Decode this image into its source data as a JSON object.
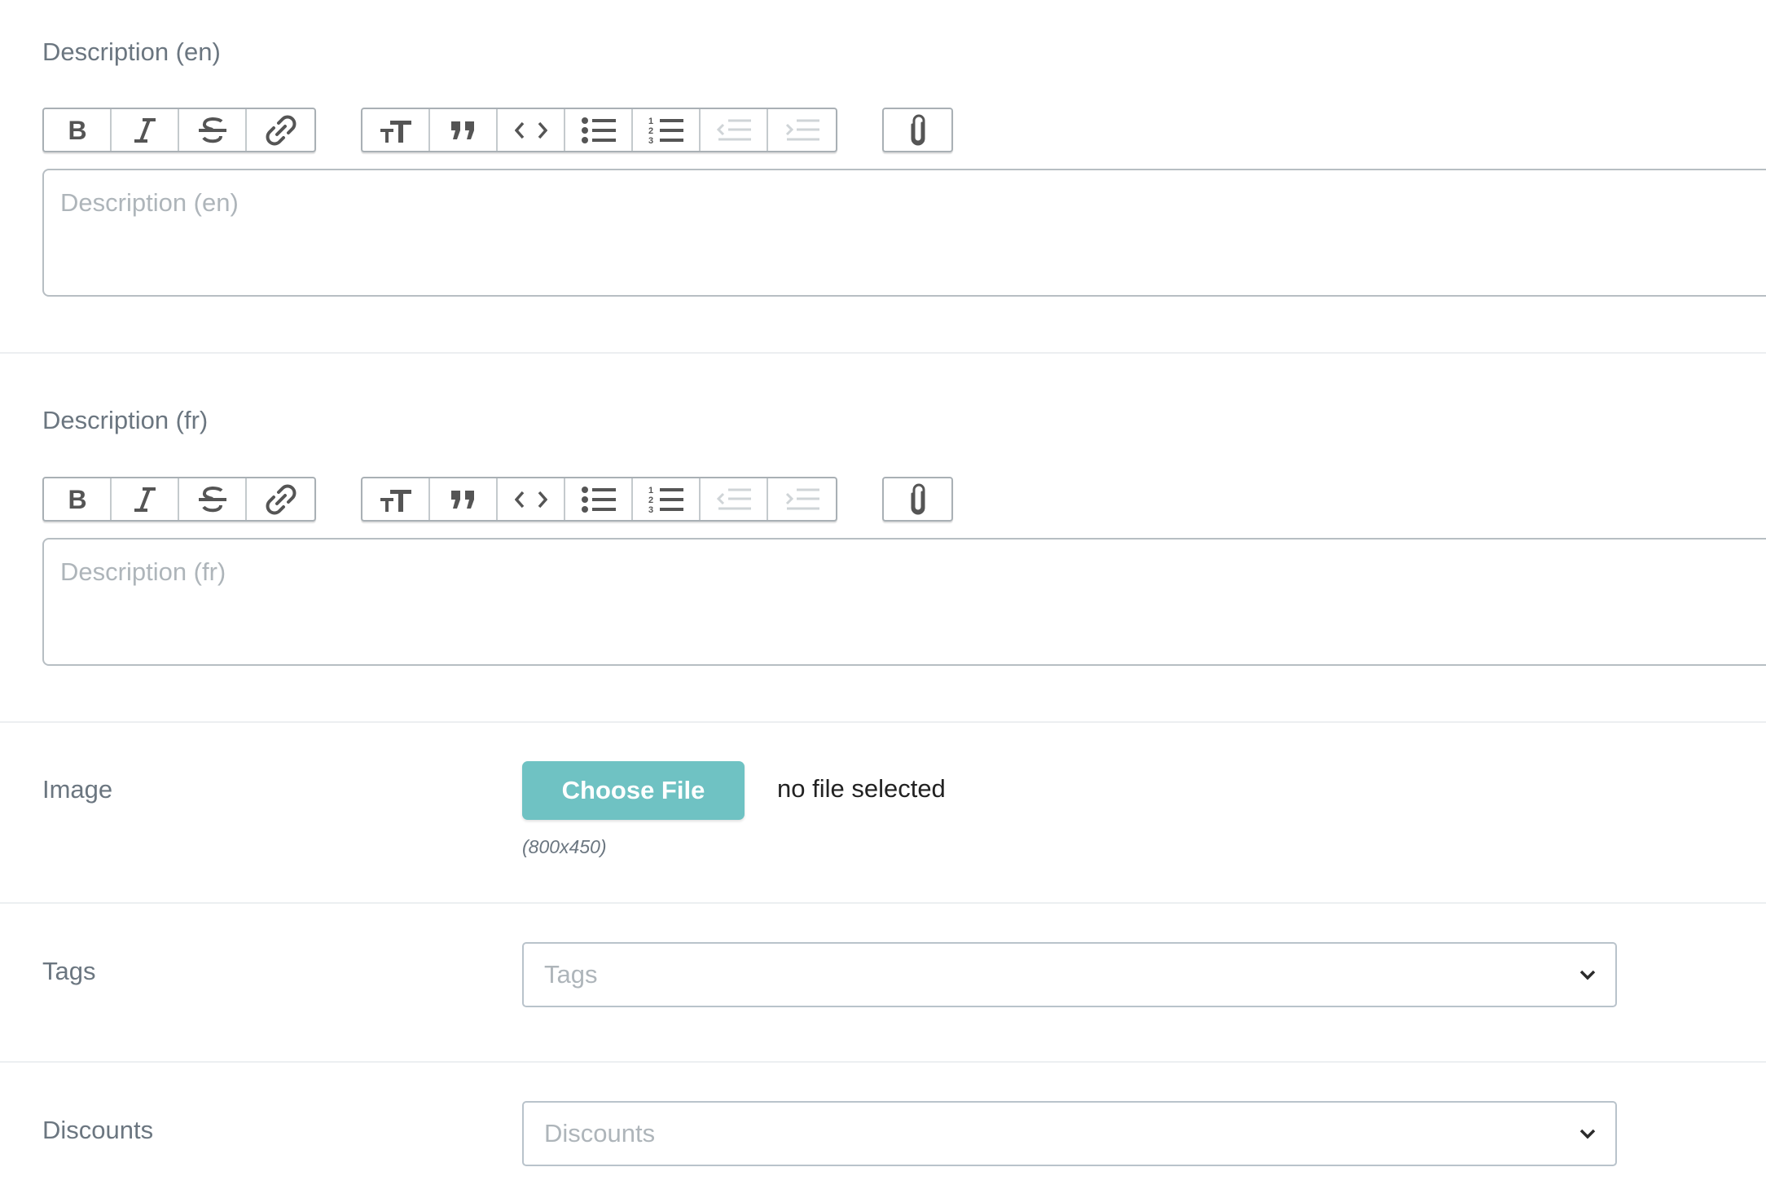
{
  "description_en": {
    "label": "Description (en)",
    "placeholder": "Description (en)"
  },
  "description_fr": {
    "label": "Description (fr)",
    "placeholder": "Description (fr)"
  },
  "toolbar": {
    "text_tools": [
      "bold-icon",
      "italic-icon",
      "strikethrough-icon",
      "link-icon"
    ],
    "block_tools": [
      "heading-icon",
      "quote-icon",
      "code-icon",
      "bullet-list-icon",
      "numbered-list-icon",
      "outdent-icon",
      "indent-icon"
    ],
    "file_tools": [
      "paperclip-icon"
    ],
    "disabled": [
      "outdent-icon",
      "indent-icon"
    ]
  },
  "image": {
    "label": "Image",
    "button_label": "Choose File",
    "status": "no file selected",
    "hint": "(800x450)"
  },
  "tags": {
    "label": "Tags",
    "placeholder": "Tags"
  },
  "discounts": {
    "label": "Discounts",
    "placeholder": "Discounts"
  },
  "colors": {
    "accent": "#6fc2c3",
    "label_text": "#6b7680",
    "placeholder_text": "#aeb5ba",
    "icon": "#555555",
    "icon_disabled": "#cfd4d7"
  }
}
